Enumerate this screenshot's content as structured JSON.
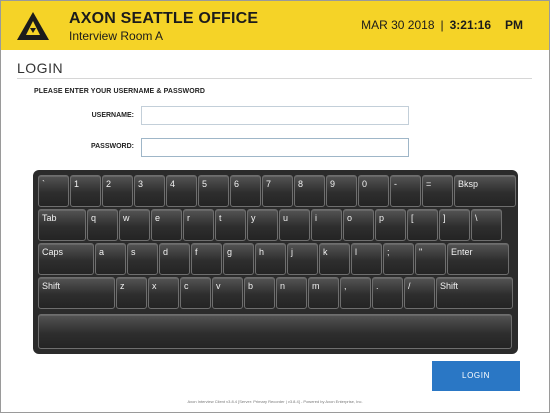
{
  "header": {
    "office_name": "AXON SEATTLE OFFICE",
    "room_name": "Interview Room A",
    "date": "MAR 30 2018",
    "separator": "|",
    "time": "3:21:16",
    "ampm": "PM",
    "brand_color": "#f5d327"
  },
  "login": {
    "title": "LOGIN",
    "instruction": "PLEASE ENTER YOUR USERNAME & PASSWORD",
    "username_label": "USERNAME:",
    "username_value": "",
    "password_label": "PASSWORD:",
    "password_value": "",
    "button_label": "LOGIN",
    "button_color": "#2a77c5"
  },
  "keyboard": {
    "rows": [
      [
        "`",
        "1",
        "2",
        "3",
        "4",
        "5",
        "6",
        "7",
        "8",
        "9",
        "0",
        "-",
        "=",
        "Bksp"
      ],
      [
        "Tab",
        "q",
        "w",
        "e",
        "r",
        "t",
        "y",
        "u",
        "i",
        "o",
        "p",
        "[",
        "]",
        "\\"
      ],
      [
        "Caps",
        "a",
        "s",
        "d",
        "f",
        "g",
        "h",
        "j",
        "k",
        "l",
        ";",
        "\"",
        "Enter"
      ],
      [
        "Shift",
        "z",
        "x",
        "c",
        "v",
        "b",
        "n",
        "m",
        ",",
        ".",
        "/",
        "Shift"
      ],
      [
        ""
      ]
    ]
  },
  "footer": {
    "text": "Axon Interview Client v3.8.4 [Server: Primary Recorder | v3.8.4] - Powered by Axon Enterprise, Inc."
  }
}
